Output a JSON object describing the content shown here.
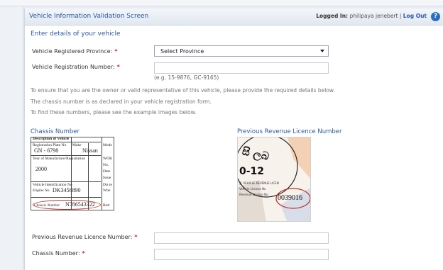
{
  "browser": {
    "crumb": ""
  },
  "header": {
    "title": "Vehicle Information Validation Screen",
    "logged_in_label": "Logged In:",
    "user": "philipaya jenebert",
    "separator": "|",
    "logout": "Log Out",
    "help_icon": "?"
  },
  "section_title": "Enter details of your vehicle",
  "fields": {
    "province_label": "Vehicle Registered Province:",
    "province_value": "Select Province",
    "reg_number_label": "Vehicle Registration Number:",
    "reg_number_value": "",
    "reg_number_hint": "(e.g. 15-9876, GC-9165)",
    "prev_licence_label": "Previous Revenue Licence Number:",
    "prev_licence_value": "",
    "chassis_label": "Chassis Number:",
    "chassis_value": "",
    "required_mark": "*"
  },
  "info": {
    "line1": "To ensure that you are the owner or valid representative of this vehicle, please provide the required details below.",
    "line2": "The chassis number is as declared in your vehicle registration form.",
    "line3": "To find these numbers, please see the example images below."
  },
  "examples": {
    "chassis_title": "Chassis Number",
    "licence_title": "Previous Revenue Licence Number",
    "chassis_doc": {
      "header": "Description of Vehicle",
      "reg_plate_label": "Registration Plate No",
      "reg_plate_value": "GN - 6798",
      "make_label": "Make",
      "make_value": "Nissan",
      "model_label": "Mode",
      "yom_label": "Year of Manufacture/Registration",
      "yom_value": "2000",
      "wor_label": "WOR",
      "no_label": "No.",
      "date_label": "Date",
      "issue_label": "Issue",
      "vin_label": "Vehicle Identification No",
      "engine_label": "Engine No.",
      "engine_value": "DK3456890",
      "dist_label": "Dis te",
      "whe_label": "Whe",
      "chassis_label": "Chassis Number",
      "chassis_value": "N786543322",
      "bot_label": "Bott"
    },
    "licence_doc": {
      "sinhala": "සි ලබ",
      "number_frag": "0-12",
      "number_value": "0039016",
      "field_a": "ශ්‍රී. VEHICLE REVENUE LICEN",
      "field_b": "Vehicle Licence No",
      "field_c": "Revenue Licence No"
    }
  },
  "colors": {
    "accent": "#2a5aa3",
    "required": "#e02020",
    "ring": "#c0302a"
  }
}
